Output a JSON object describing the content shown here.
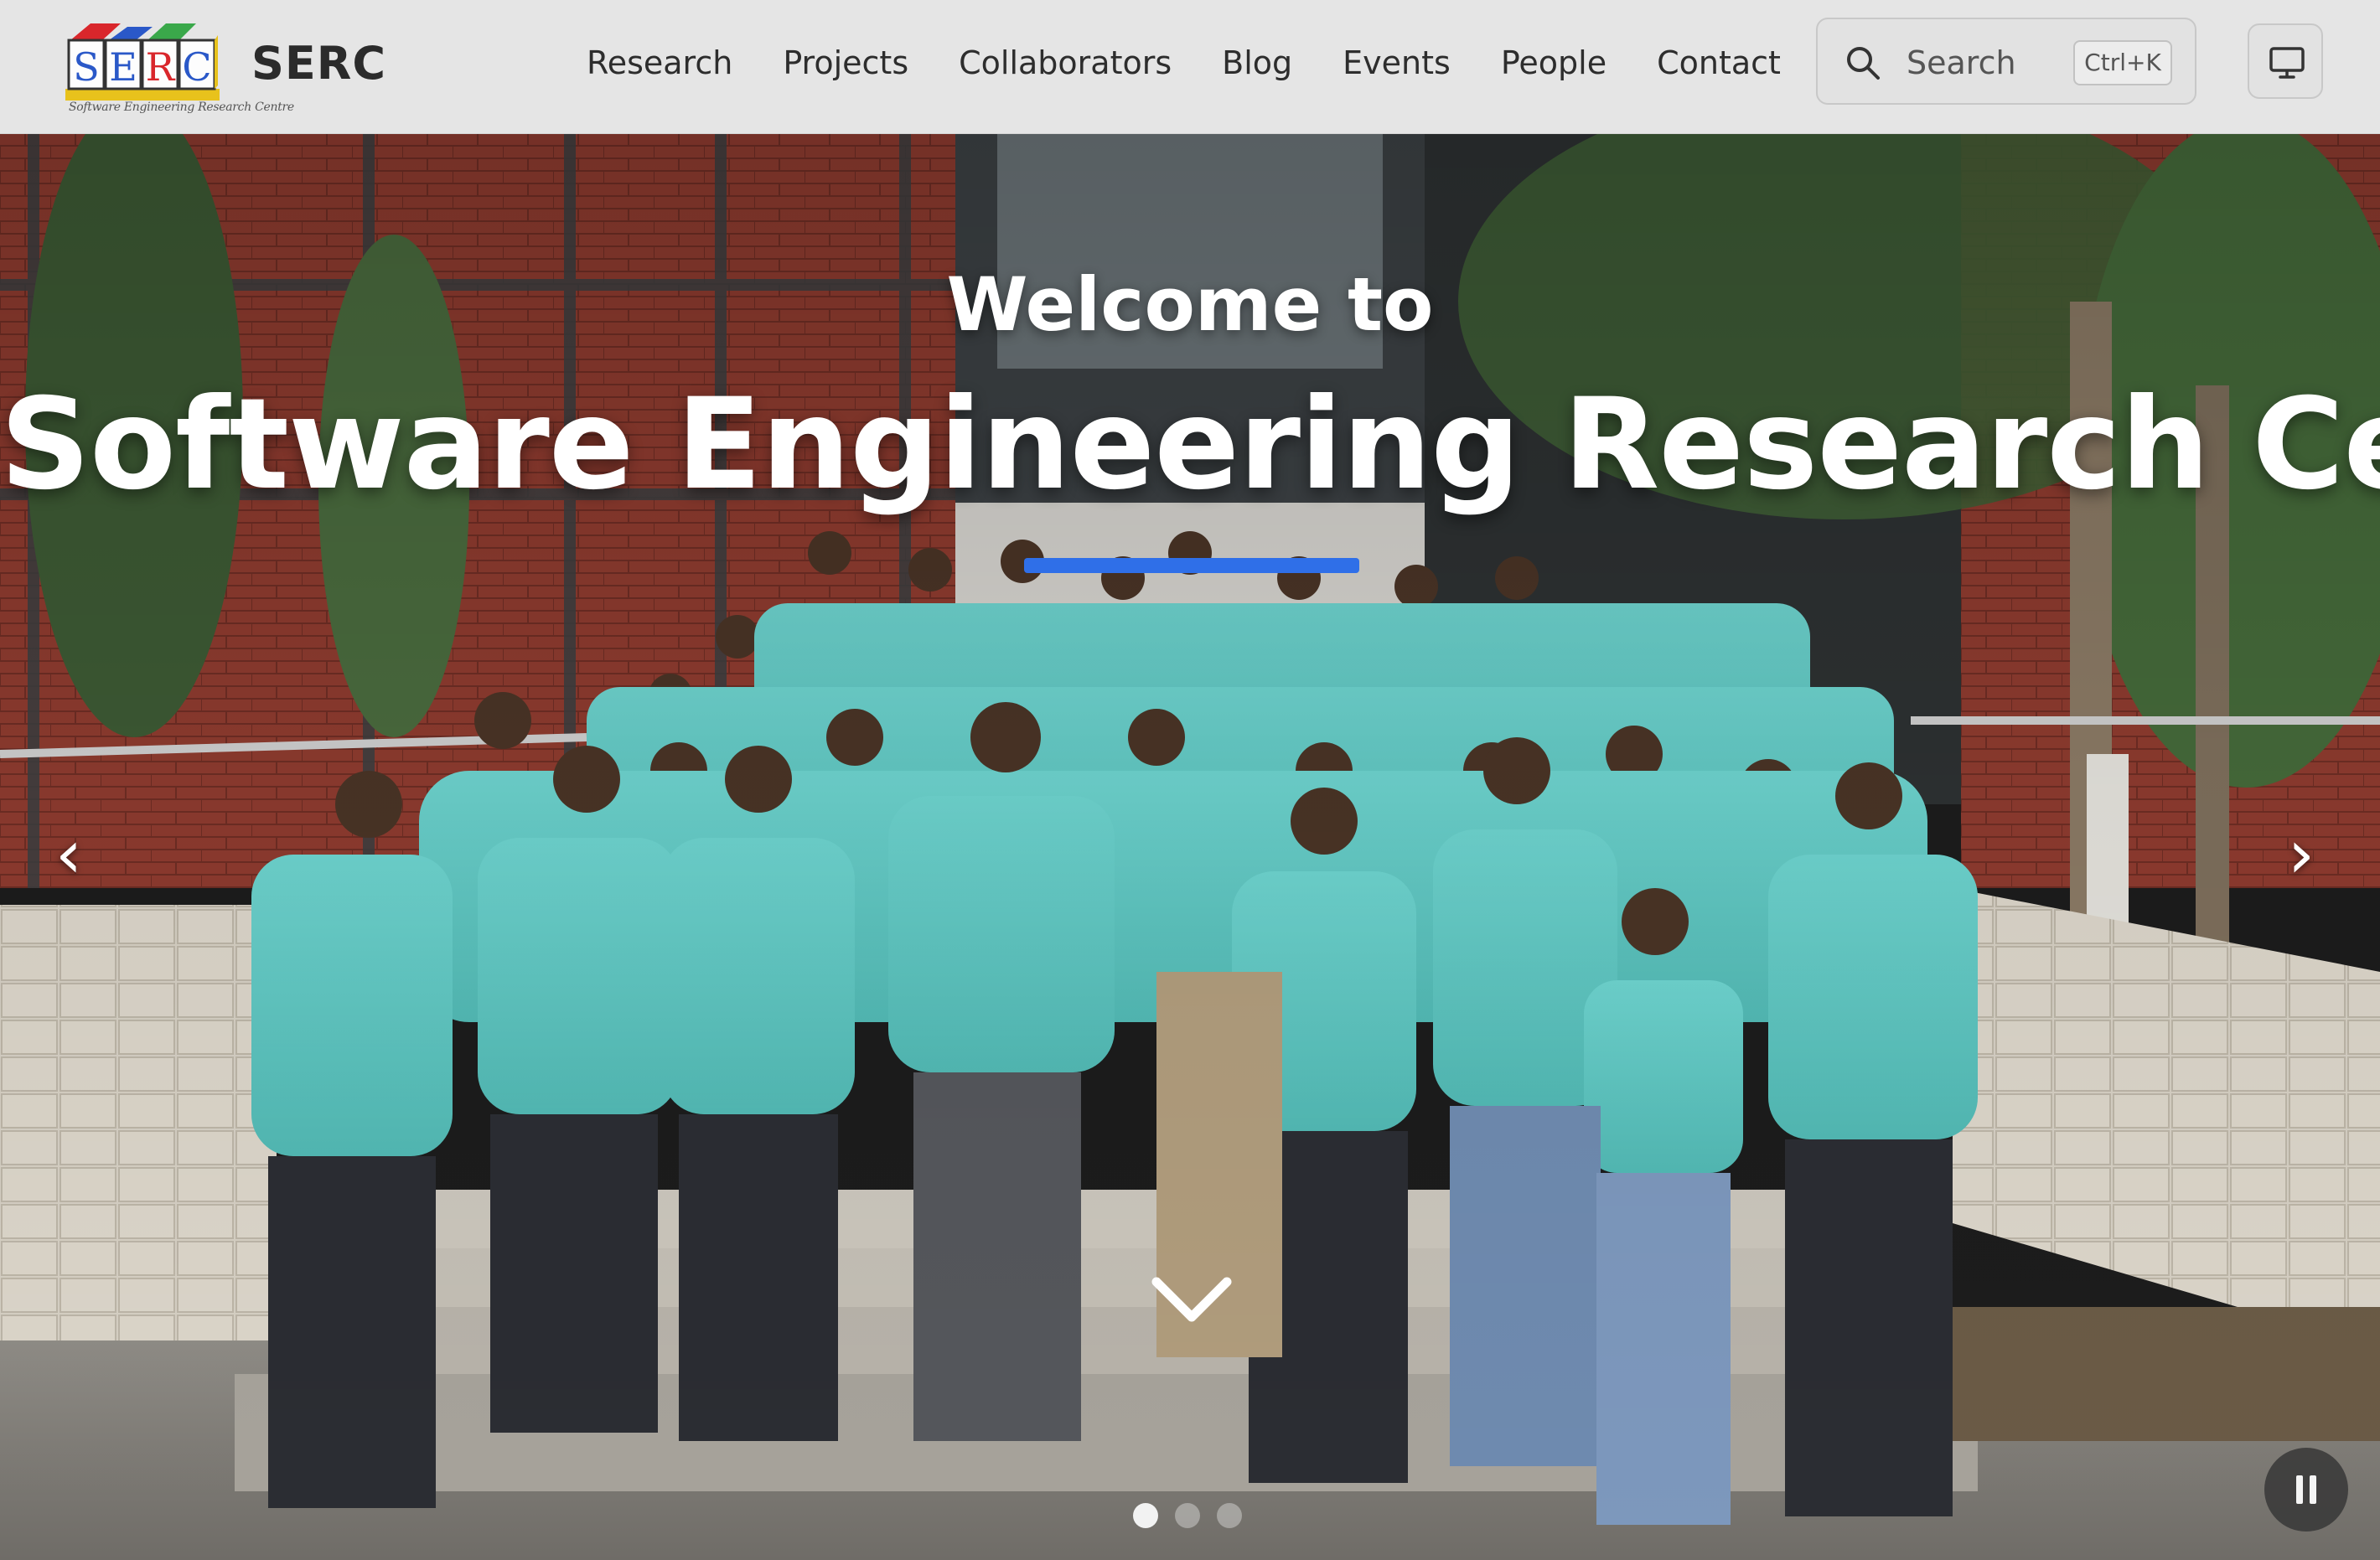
{
  "header": {
    "logo": {
      "letters": [
        "S",
        "E",
        "R",
        "C"
      ],
      "tagline": "Software Engineering Research Centre",
      "colors": [
        "#d9262b",
        "#1f7a2f",
        "#2a58c8",
        "#e8c21c",
        "#3aa84a"
      ]
    },
    "brand": "SERC",
    "nav": [
      {
        "label": "Research"
      },
      {
        "label": "Projects"
      },
      {
        "label": "Collaborators"
      },
      {
        "label": "Blog"
      },
      {
        "label": "Events"
      },
      {
        "label": "People"
      },
      {
        "label": "Contact"
      }
    ],
    "search": {
      "placeholder": "Search",
      "shortcut": "Ctrl+K",
      "icon": "search-icon"
    },
    "theme_toggle": {
      "icon": "monitor-icon"
    }
  },
  "hero": {
    "welcome": "Welcome to",
    "headline": "Software Engineering Research Centre",
    "accent_color": "#2f6fe8",
    "prev_label": "‹",
    "next_label": "›",
    "scroll_icon": "chevron-down-icon",
    "slides": 3,
    "active_slide": 1,
    "pause_icon": "pause-icon",
    "photo_description_colors": {
      "shirt": "#5ec9c4",
      "brick": "#8e3b2f",
      "stone": "#d6d0c4"
    }
  }
}
